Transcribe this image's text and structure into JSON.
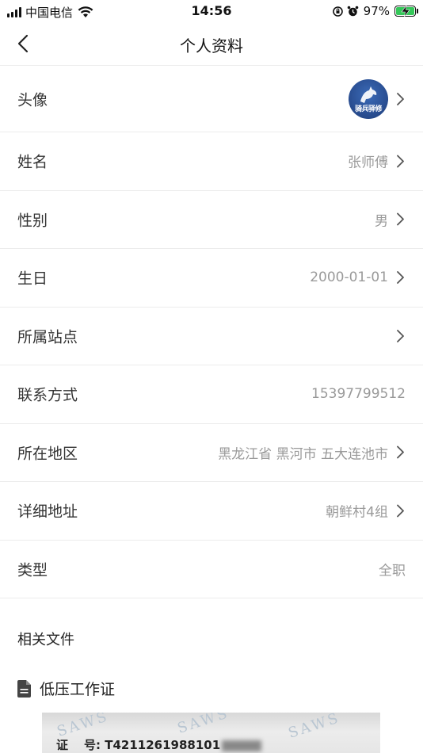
{
  "status_bar": {
    "carrier": "中国电信",
    "time": "14:56",
    "battery_percent": "97%"
  },
  "nav": {
    "title": "个人资料"
  },
  "rows": [
    {
      "label": "头像",
      "value": "",
      "avatar_text": "骑兵驿修",
      "chevron": true
    },
    {
      "label": "姓名",
      "value": "张师傅",
      "chevron": true
    },
    {
      "label": "性别",
      "value": "男",
      "chevron": true
    },
    {
      "label": "生日",
      "value": "2000-01-01",
      "chevron": true
    },
    {
      "label": "所属站点",
      "value": "",
      "chevron": true
    },
    {
      "label": "联系方式",
      "value": "15397799512",
      "chevron": false
    },
    {
      "label": "所在地区",
      "value": "黑龙江省 黑河市 五大连池市",
      "chevron": true
    },
    {
      "label": "详细地址",
      "value": "朝鲜村4组",
      "chevron": true
    },
    {
      "label": "类型",
      "value": "全职",
      "chevron": false
    }
  ],
  "files": {
    "section_title": "相关文件",
    "items": [
      {
        "label": "低压工作证",
        "image_caption": "证",
        "image_number_label": "号:",
        "image_number": "T4211261988101",
        "watermark": "SAWS"
      }
    ]
  },
  "colors": {
    "divider": "#ececec",
    "value_text": "#9a9a9a",
    "battery_green": "#34c759",
    "avatar_blue": "#2a4f93"
  },
  "icons": {
    "back": "chevron-left-icon",
    "row_chevron": "chevron-right-icon",
    "document": "document-icon"
  }
}
